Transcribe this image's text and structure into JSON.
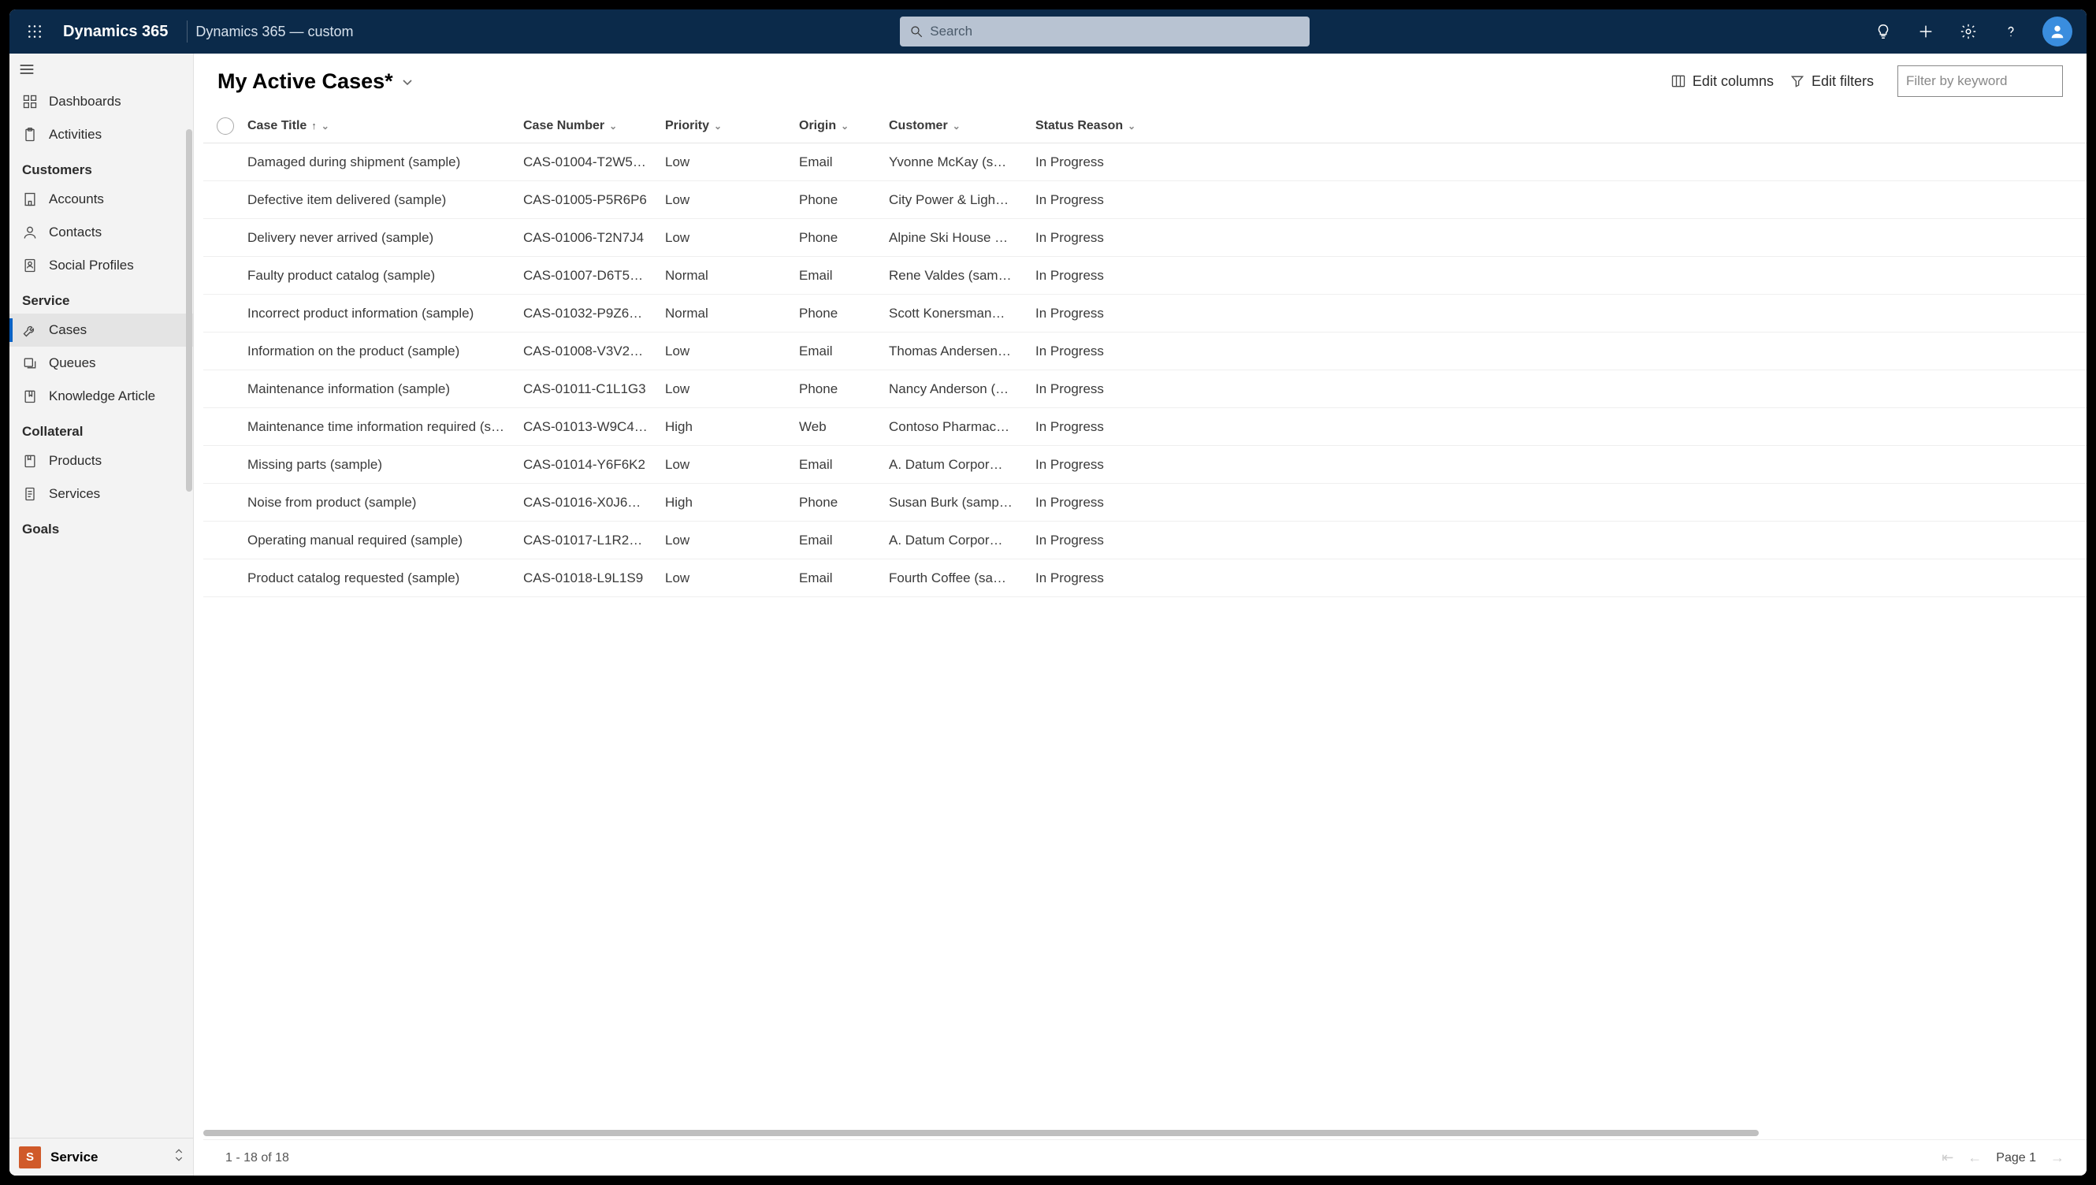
{
  "topbar": {
    "brand": "Dynamics 365",
    "breadcrumb": "Dynamics 365 — custom",
    "search_placeholder": "Search"
  },
  "sidebar": {
    "top_items": [
      {
        "icon": "dashboard",
        "label": "Dashboards"
      },
      {
        "icon": "clipboard",
        "label": "Activities"
      }
    ],
    "groups": [
      {
        "title": "Customers",
        "items": [
          {
            "icon": "building",
            "label": "Accounts"
          },
          {
            "icon": "person",
            "label": "Contacts"
          },
          {
            "icon": "social",
            "label": "Social Profiles"
          }
        ]
      },
      {
        "title": "Service",
        "items": [
          {
            "icon": "wrench",
            "label": "Cases",
            "active": true
          },
          {
            "icon": "queues",
            "label": "Queues"
          },
          {
            "icon": "book",
            "label": "Knowledge Article"
          }
        ]
      },
      {
        "title": "Collateral",
        "items": [
          {
            "icon": "product",
            "label": "Products"
          },
          {
            "icon": "doc",
            "label": "Services"
          }
        ]
      },
      {
        "title": "Goals",
        "items": []
      }
    ],
    "app_switcher": {
      "letter": "S",
      "name": "Service"
    }
  },
  "main": {
    "view_title": "My Active Cases*",
    "edit_columns": "Edit columns",
    "edit_filters": "Edit filters",
    "filter_placeholder": "Filter by keyword",
    "columns": [
      {
        "label": "Case Title",
        "sort": "asc"
      },
      {
        "label": "Case Number"
      },
      {
        "label": "Priority"
      },
      {
        "label": "Origin"
      },
      {
        "label": "Customer"
      },
      {
        "label": "Status Reason"
      }
    ],
    "rows": [
      {
        "title": "Damaged during shipment (sample)",
        "number": "CAS-01004-T2W5…",
        "priority": "Low",
        "origin": "Email",
        "customer": "Yvonne McKay (s…",
        "status": "In Progress"
      },
      {
        "title": "Defective item delivered (sample)",
        "number": "CAS-01005-P5R6P6",
        "priority": "Low",
        "origin": "Phone",
        "customer": "City Power & Ligh…",
        "status": "In Progress"
      },
      {
        "title": "Delivery never arrived (sample)",
        "number": "CAS-01006-T2N7J4",
        "priority": "Low",
        "origin": "Phone",
        "customer": "Alpine Ski House …",
        "status": "In Progress"
      },
      {
        "title": "Faulty product catalog (sample)",
        "number": "CAS-01007-D6T5…",
        "priority": "Normal",
        "origin": "Email",
        "customer": "Rene Valdes (sam…",
        "status": "In Progress"
      },
      {
        "title": "Incorrect product information (sample)",
        "number": "CAS-01032-P9Z6…",
        "priority": "Normal",
        "origin": "Phone",
        "customer": "Scott Konersman…",
        "status": "In Progress"
      },
      {
        "title": "Information on the product (sample)",
        "number": "CAS-01008-V3V2…",
        "priority": "Low",
        "origin": "Email",
        "customer": "Thomas Andersen…",
        "status": "In Progress"
      },
      {
        "title": "Maintenance information (sample)",
        "number": "CAS-01011-C1L1G3",
        "priority": "Low",
        "origin": "Phone",
        "customer": "Nancy Anderson (…",
        "status": "In Progress"
      },
      {
        "title": "Maintenance time information required (s…",
        "number": "CAS-01013-W9C4…",
        "priority": "High",
        "origin": "Web",
        "customer": "Contoso Pharmac…",
        "status": "In Progress"
      },
      {
        "title": "Missing parts (sample)",
        "number": "CAS-01014-Y6F6K2",
        "priority": "Low",
        "origin": "Email",
        "customer": "A. Datum Corpor…",
        "status": "In Progress"
      },
      {
        "title": "Noise from product (sample)",
        "number": "CAS-01016-X0J6…",
        "priority": "High",
        "origin": "Phone",
        "customer": "Susan Burk (samp…",
        "status": "In Progress"
      },
      {
        "title": "Operating manual required (sample)",
        "number": "CAS-01017-L1R2…",
        "priority": "Low",
        "origin": "Email",
        "customer": "A. Datum Corpor…",
        "status": "In Progress"
      },
      {
        "title": "Product catalog requested (sample)",
        "number": "CAS-01018-L9L1S9",
        "priority": "Low",
        "origin": "Email",
        "customer": "Fourth Coffee (sa…",
        "status": "In Progress"
      }
    ],
    "footer": {
      "range": "1 - 18 of 18",
      "page_label": "Page 1"
    }
  }
}
